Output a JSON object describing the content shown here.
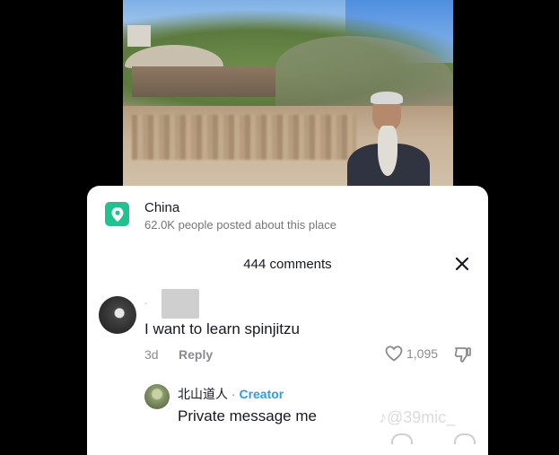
{
  "place": {
    "title": "China",
    "subtitle": "62.0K people posted about this place"
  },
  "comments": {
    "header": "444 comments"
  },
  "comment1": {
    "text": "I want to learn spinjitzu",
    "time": "3d",
    "reply_label": "Reply",
    "likes": "1,095"
  },
  "reply1": {
    "author": "北山道人",
    "separator": "·",
    "badge": "Creator",
    "text": "Private message me"
  },
  "watermark": "@39mic_",
  "colors": {
    "place_icon": "#1ec48f",
    "creator_badge": "#2a9df4",
    "secondary_text": "#8a8b91"
  }
}
